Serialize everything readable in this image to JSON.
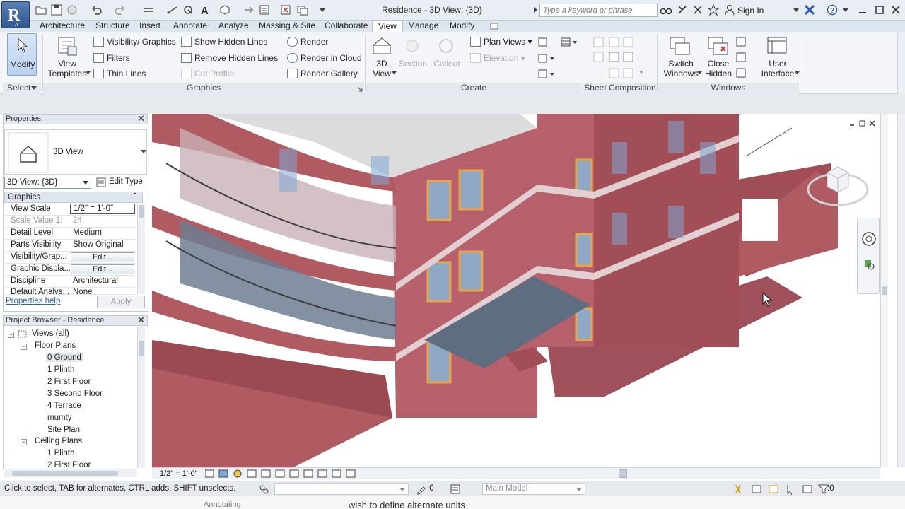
{
  "window": {
    "title": "Residence - 3D View: {3D}",
    "search_placeholder": "Type a keyword or phrase",
    "sign_in": "Sign In"
  },
  "tabs": [
    "Architecture",
    "Structure",
    "Insert",
    "Annotate",
    "Analyze",
    "Massing & Site",
    "Collaborate",
    "View",
    "Manage",
    "Modify"
  ],
  "active_tab": "View",
  "ribbon": {
    "modify": "Modify",
    "select": "Select",
    "view_templates": [
      "View",
      "Templates"
    ],
    "graphics_items": [
      "Visibility/ Graphics",
      "Filters",
      "Thin  Lines",
      "Show  Hidden Lines",
      "Remove  Hidden Lines",
      "Cut  Profile",
      "Render",
      "Render  in Cloud",
      "Render  Gallery"
    ],
    "graphics_title": "Graphics",
    "create_items": [
      "3D",
      "View",
      "Section",
      "Callout",
      "Plan  Views",
      "Elevation"
    ],
    "create_title": "Create",
    "sheet_title": "Sheet Composition",
    "windows_items": [
      "Switch",
      "Windows",
      "Close",
      "Hidden",
      "User",
      "Interface"
    ],
    "windows_title": "Windows"
  },
  "properties": {
    "header": "Properties",
    "type_name": "3D View",
    "instance": "3D View: {3D}",
    "edit_type": "Edit Type",
    "section": "Graphics",
    "rows": [
      {
        "label": "View Scale",
        "value": "1/2\" = 1'-0\""
      },
      {
        "label": "Scale Value    1:",
        "value": "24"
      },
      {
        "label": "Detail Level",
        "value": "Medium"
      },
      {
        "label": "Parts Visibility",
        "value": "Show Original"
      },
      {
        "label": "Visibility/Grap...",
        "value": "Edit..."
      },
      {
        "label": "Graphic Displa...",
        "value": "Edit..."
      },
      {
        "label": "Discipline",
        "value": "Architectural"
      },
      {
        "label": "Default Analys...",
        "value": "None"
      }
    ],
    "help": "Properties help",
    "apply": "Apply"
  },
  "browser": {
    "header": "Project Browser - Residence",
    "views_all": "Views (all)",
    "floor_plans": "Floor Plans",
    "floor_items": [
      "0 Ground",
      "1 Plinth",
      "2 First Floor",
      "3 Second Floor",
      "4 Terrace",
      "mumty",
      "Site Plan"
    ],
    "ceiling_plans": "Ceiling Plans",
    "ceiling_items": [
      "1 Plinth",
      "2 First Floor"
    ]
  },
  "view_scale": "1/2\" = 1'-0\"",
  "status": {
    "hint": "Click to select, TAB for alternates, CTRL adds, SHIFT unselects.",
    "count": ":0",
    "model": "Main Model",
    "filter_count": ":0"
  },
  "below_text": "wish to define alternate units",
  "below_left": "Annotating",
  "colors": {
    "wall": "#b05a62",
    "wall_dark": "#8f3f47",
    "glass": "#7ea8d6",
    "frame": "#e8a746"
  }
}
